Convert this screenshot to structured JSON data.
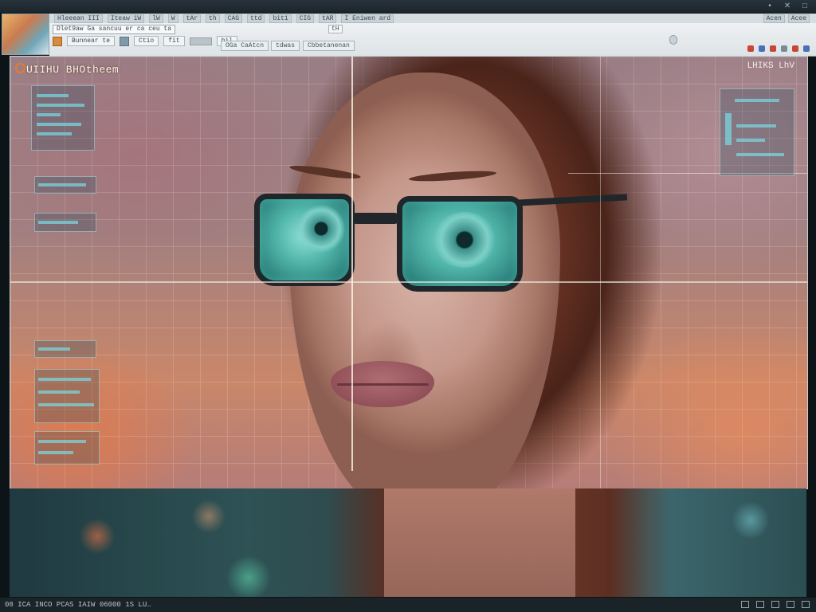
{
  "window": {
    "controls": [
      "•",
      "✕",
      "□"
    ]
  },
  "menubar": {
    "items": [
      "Hleeean III",
      "Iteaw iW",
      "lW",
      "W",
      "tAr",
      "th",
      "CAG",
      "ttd",
      "bit1",
      "CIG",
      "tAR",
      "I Eniwen ard"
    ],
    "right": [
      "Acen",
      "Acee"
    ]
  },
  "ribbon": {
    "path_box": "Dlet9aw Ga sancuu er ca ceu ta",
    "mid_label": "tH",
    "row2": [
      "Bunnear te",
      "Ctio",
      "fit",
      "hil"
    ],
    "group_tabs": [
      "OGa CaAtcn",
      "tdwas",
      "Cbbetanenan"
    ],
    "tool_colors": [
      "#c84636",
      "#4b6fb8",
      "#c84636",
      "#7a8a94",
      "#c84636",
      "#4b6fb8"
    ]
  },
  "canvas": {
    "title": "UIIHU BHOtheem",
    "right_label": "LHIKS LhV"
  },
  "statusbar": {
    "text": "08 ICA INCO PCAS IAIW 06000 1S LU…"
  },
  "colors": {
    "accent_orange": "#e57b2d",
    "lens_teal": "#4fb3a8",
    "chrome_dark": "#1b252c"
  }
}
